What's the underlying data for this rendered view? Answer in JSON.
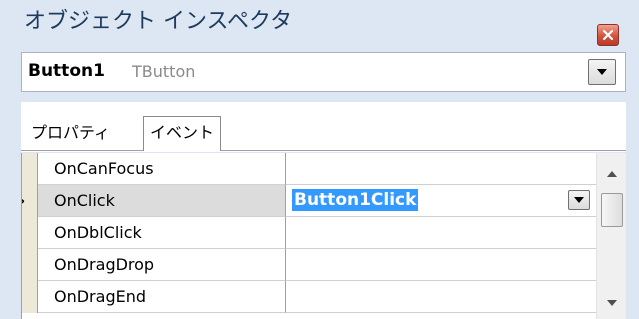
{
  "window": {
    "title": "オブジェクト インスペクタ"
  },
  "component": {
    "name": "Button1",
    "type": "TButton"
  },
  "tabs": [
    {
      "label": "プロパティ",
      "active": false
    },
    {
      "label": "イベント",
      "active": true
    }
  ],
  "events": [
    {
      "name": "OnCanFocus",
      "value": ""
    },
    {
      "name": "OnClick",
      "value": "Button1Click",
      "selected": true
    },
    {
      "name": "OnDblClick",
      "value": ""
    },
    {
      "name": "OnDragDrop",
      "value": ""
    },
    {
      "name": "OnDragEnd",
      "value": ""
    }
  ],
  "selected_marker": "»",
  "colors": {
    "window_bg": "#dde7f3",
    "selection": "#3399ff",
    "close_button": "#d2533e"
  },
  "icons": {
    "close": "close-icon",
    "dropdown": "chevron-down-icon",
    "scroll_up": "scroll-up-icon",
    "scroll_down": "scroll-down-icon"
  }
}
